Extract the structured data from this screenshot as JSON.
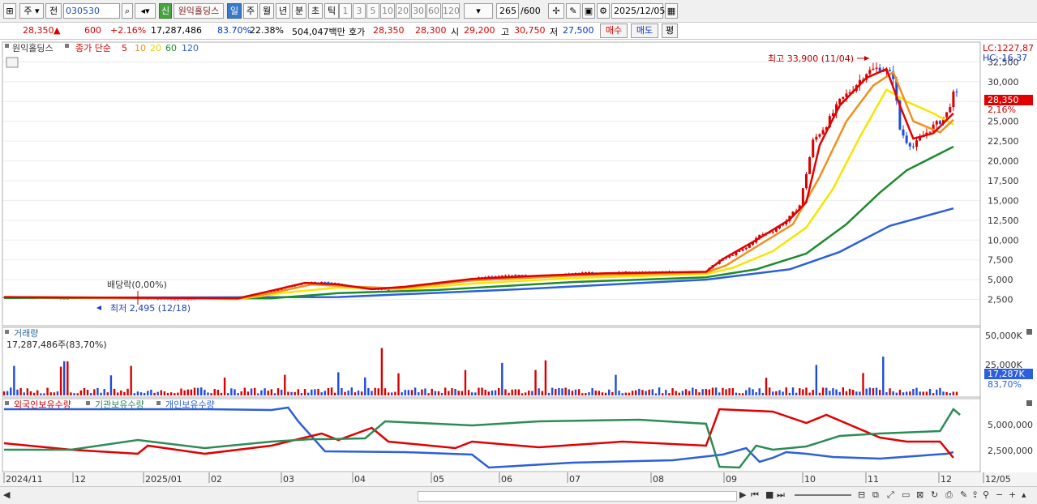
{
  "toolbar": {
    "period_label": "주",
    "prev_label": "전",
    "code": "030530",
    "stock_badge": "신",
    "stock_name": "원익홀딩스",
    "period_buttons": [
      "일",
      "주",
      "월",
      "년",
      "분",
      "초",
      "틱"
    ],
    "interval_buttons": [
      "1",
      "3",
      "5",
      "10",
      "20",
      "30",
      "60",
      "120"
    ],
    "count": "265",
    "count_total": "/600",
    "date": "2025/12/05"
  },
  "quote": {
    "price": "28,350",
    "arrow": "▲",
    "change": "600",
    "change_pct": "+2.16%",
    "volume": "17,287,486",
    "vol_ratio": "83.70%",
    "turnover": "22.38%",
    "amount": "504,047백만",
    "bid_label": "호가",
    "bid": "28,350",
    "ask": "28,300",
    "open_label": "시",
    "open": "29,200",
    "high_label": "고",
    "high": "30,750",
    "low_label": "저",
    "low": "27,500",
    "buy_label": "매수",
    "sell_label": "매도",
    "avg_label": "평"
  },
  "legend": {
    "name": "원익홀딩스",
    "ma_label": "종가 단순",
    "ma_periods": [
      "5",
      "10",
      "20",
      "60",
      "120"
    ]
  },
  "volume_panel": {
    "title": "거래량",
    "value": "17,287,486주(83,70%)",
    "axis_labels": [
      "50,000K",
      "25,000K"
    ],
    "last_label": "17,287K",
    "last_pct": "83,70%"
  },
  "holdings_panel": {
    "labels": [
      "외국인보유수량",
      "기관보유수량",
      "개인보유수량"
    ],
    "axis_labels": [
      "5,000,000",
      "2,500,000"
    ]
  },
  "annotations": {
    "high": "최고 33,900 (11/04)",
    "low": "최저 2,495 (12/18)",
    "dividend": "배당락(0,00%)",
    "lc": "LC:1227,87",
    "hc": "HC:-16,37",
    "price_tag": "28,350",
    "pct_tag": "2,16%"
  },
  "colors": {
    "up": "#d80000",
    "down": "#1f4bd8",
    "ma5": "#e00000",
    "ma10": "#f0901e",
    "ma20": "#f5e600",
    "ma60": "#1e8a2e",
    "ma120": "#2b5fdb",
    "foreign": "#e00000",
    "institution": "#2e8b57",
    "individual": "#2b5fdb"
  },
  "chart_data": {
    "type": "candlestick",
    "x_ticks": [
      "2024/11",
      "12",
      "2025/01",
      "02",
      "03",
      "04",
      "05",
      "06",
      "07",
      "08",
      "09",
      "10",
      "11",
      "12",
      "12/05"
    ],
    "y_ticks": [
      "32,500",
      "30,000",
      "27,500",
      "25,000",
      "22,500",
      "20,000",
      "17,500",
      "15,000",
      "12,500",
      "10,000",
      "7,500",
      "5,000",
      "2,500"
    ],
    "ylim": [
      0,
      35000
    ],
    "price_path": [
      [
        0,
        2800
      ],
      [
        6,
        2700
      ],
      [
        12,
        2650
      ],
      [
        18,
        2600
      ],
      [
        24,
        2750
      ],
      [
        30,
        2700
      ],
      [
        36,
        2650
      ],
      [
        42,
        2600
      ],
      [
        48,
        2550
      ],
      [
        54,
        2500
      ],
      [
        60,
        2600
      ],
      [
        66,
        2650
      ],
      [
        72,
        2700
      ],
      [
        78,
        3200
      ],
      [
        84,
        4000
      ],
      [
        90,
        4600
      ],
      [
        96,
        4700
      ],
      [
        102,
        4300
      ],
      [
        108,
        3900
      ],
      [
        114,
        3700
      ],
      [
        120,
        4100
      ],
      [
        126,
        4300
      ],
      [
        132,
        4500
      ],
      [
        138,
        4900
      ],
      [
        144,
        5400
      ],
      [
        150,
        5600
      ],
      [
        156,
        5500
      ],
      [
        162,
        5400
      ],
      [
        168,
        5700
      ],
      [
        174,
        5900
      ],
      [
        180,
        5800
      ],
      [
        186,
        5950
      ],
      [
        192,
        5900
      ],
      [
        198,
        6000
      ],
      [
        204,
        5800
      ],
      [
        210,
        6100
      ],
      [
        214,
        7400
      ],
      [
        218,
        8200
      ],
      [
        222,
        9000
      ],
      [
        226,
        10600
      ],
      [
        230,
        11200
      ],
      [
        234,
        12400
      ],
      [
        238,
        14400
      ],
      [
        242,
        22500
      ],
      [
        246,
        24600
      ],
      [
        250,
        27500
      ],
      [
        254,
        29200
      ],
      [
        258,
        31200
      ],
      [
        262,
        31800
      ],
      [
        266,
        30700
      ],
      [
        268,
        24000
      ],
      [
        270,
        22500
      ],
      [
        272,
        21800
      ],
      [
        274,
        22800
      ],
      [
        276,
        23600
      ],
      [
        278,
        24400
      ],
      [
        280,
        25000
      ],
      [
        282,
        26000
      ],
      [
        284,
        28350
      ]
    ],
    "ma5_path": [
      [
        0,
        2800
      ],
      [
        70,
        2650
      ],
      [
        80,
        3600
      ],
      [
        90,
        4600
      ],
      [
        100,
        4400
      ],
      [
        110,
        3800
      ],
      [
        120,
        4100
      ],
      [
        140,
        5100
      ],
      [
        160,
        5500
      ],
      [
        180,
        5800
      ],
      [
        210,
        6000
      ],
      [
        215,
        7600
      ],
      [
        225,
        10000
      ],
      [
        235,
        12600
      ],
      [
        240,
        14800
      ],
      [
        244,
        22000
      ],
      [
        250,
        27000
      ],
      [
        258,
        30500
      ],
      [
        264,
        31600
      ],
      [
        268,
        27000
      ],
      [
        272,
        22800
      ],
      [
        278,
        23500
      ],
      [
        284,
        26000
      ]
    ],
    "ma10_path": [
      [
        0,
        2800
      ],
      [
        70,
        2600
      ],
      [
        80,
        3300
      ],
      [
        92,
        4400
      ],
      [
        105,
        4100
      ],
      [
        118,
        3900
      ],
      [
        140,
        4900
      ],
      [
        170,
        5500
      ],
      [
        210,
        5900
      ],
      [
        216,
        6800
      ],
      [
        226,
        9400
      ],
      [
        236,
        12000
      ],
      [
        244,
        18000
      ],
      [
        252,
        25000
      ],
      [
        260,
        29500
      ],
      [
        266,
        31200
      ],
      [
        272,
        25000
      ],
      [
        280,
        23600
      ],
      [
        284,
        25200
      ]
    ],
    "ma20_path": [
      [
        0,
        2800
      ],
      [
        70,
        2550
      ],
      [
        85,
        3400
      ],
      [
        100,
        4000
      ],
      [
        120,
        3800
      ],
      [
        140,
        4500
      ],
      [
        170,
        5200
      ],
      [
        210,
        5700
      ],
      [
        218,
        6500
      ],
      [
        230,
        8600
      ],
      [
        240,
        11600
      ],
      [
        248,
        16500
      ],
      [
        256,
        23000
      ],
      [
        264,
        29000
      ],
      [
        270,
        27500
      ],
      [
        278,
        26000
      ],
      [
        284,
        24600
      ]
    ],
    "ma60_path": [
      [
        0,
        2700
      ],
      [
        80,
        2650
      ],
      [
        100,
        3300
      ],
      [
        130,
        3700
      ],
      [
        170,
        4700
      ],
      [
        210,
        5300
      ],
      [
        225,
        6300
      ],
      [
        240,
        8300
      ],
      [
        252,
        12000
      ],
      [
        262,
        16000
      ],
      [
        270,
        18800
      ],
      [
        284,
        21800
      ]
    ],
    "ma120_path": [
      [
        0,
        2700
      ],
      [
        100,
        2800
      ],
      [
        150,
        3700
      ],
      [
        210,
        5000
      ],
      [
        235,
        6300
      ],
      [
        250,
        8500
      ],
      [
        265,
        11800
      ],
      [
        284,
        14000
      ]
    ],
    "volume_bars_note": "series of weekly volume bars (K shares)"
  }
}
